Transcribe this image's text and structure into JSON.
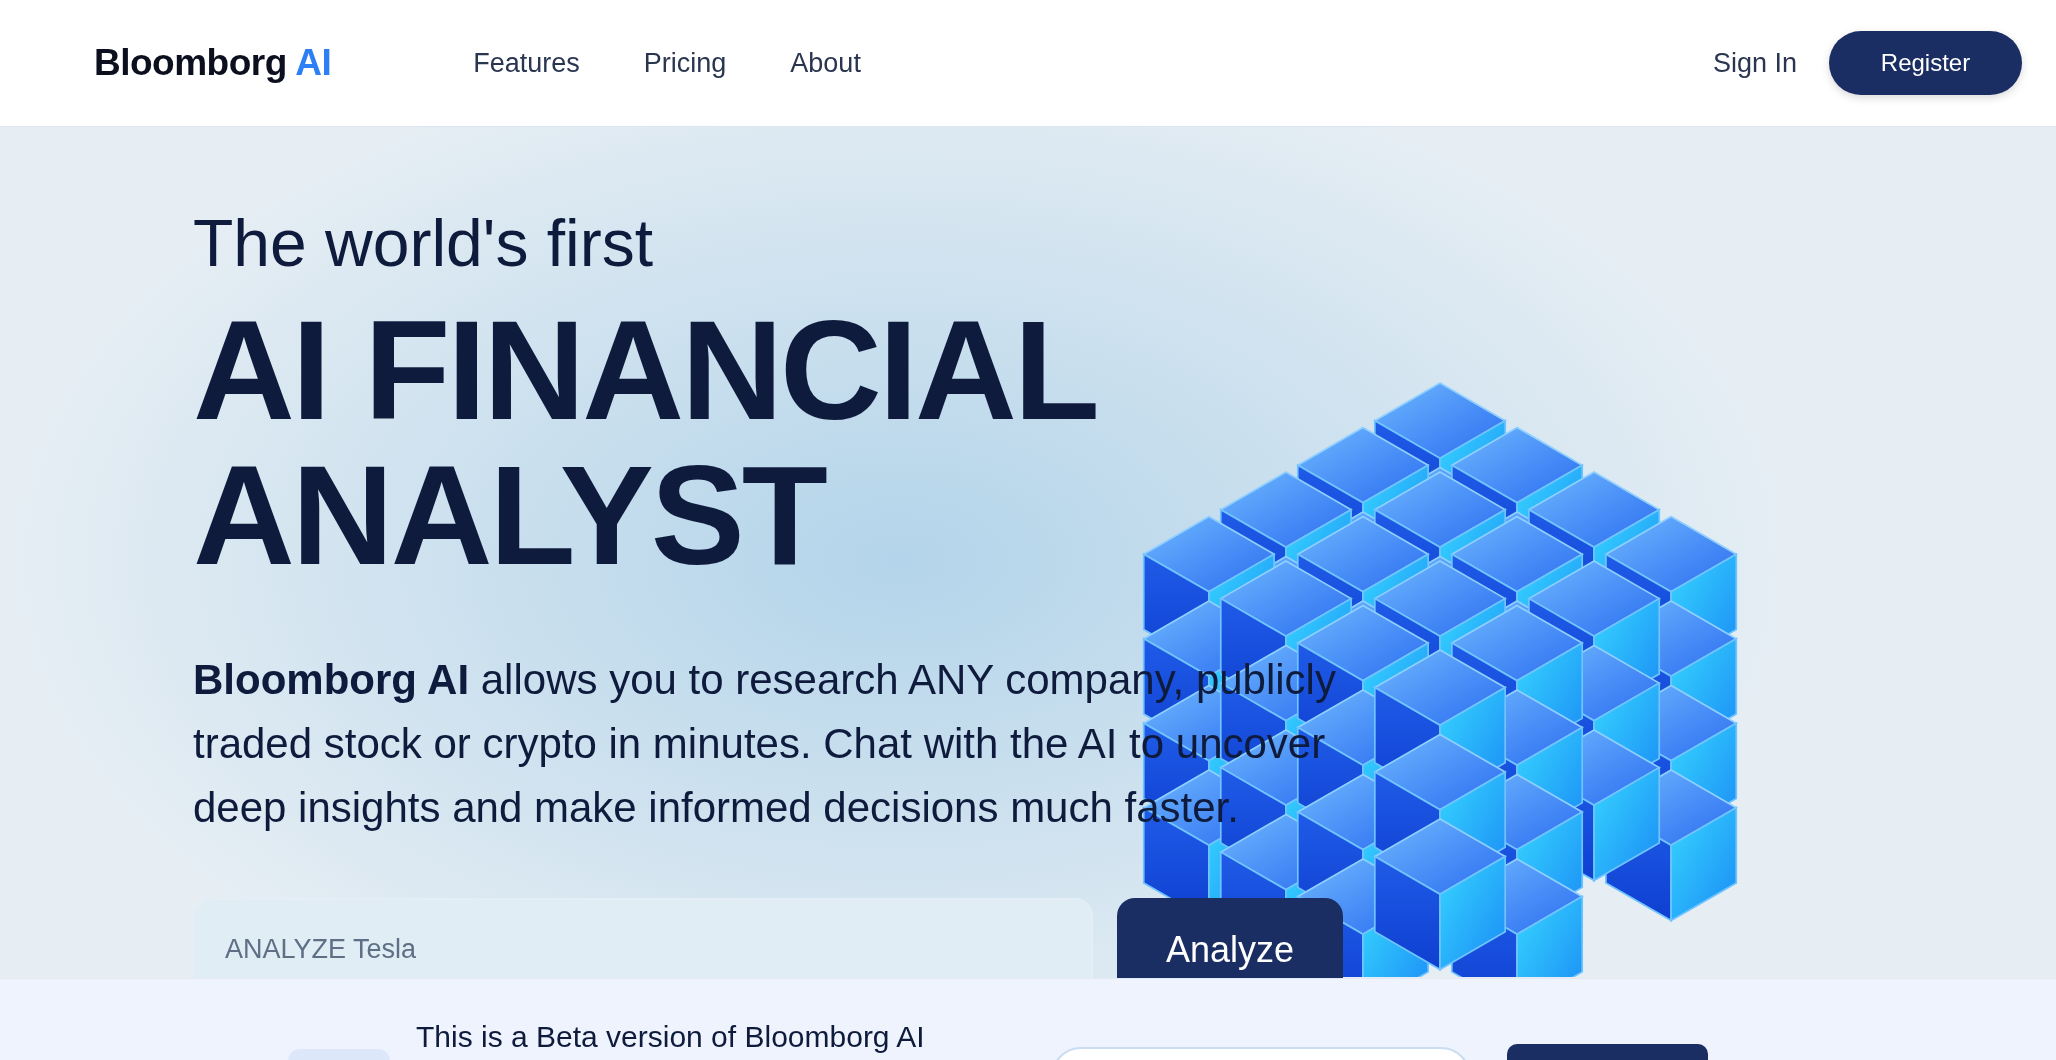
{
  "header": {
    "logo": {
      "text": "Bloomborg",
      "accent": "AI"
    },
    "nav": [
      "Features",
      "Pricing",
      "About"
    ],
    "sign_in": "Sign In",
    "register": "Register"
  },
  "hero": {
    "kicker": "The world's first",
    "headline_lines": [
      "AI FINANCIAL",
      "ANALYST"
    ],
    "description": "**Bloomborg AI** allows you to research ANY company, publicly traded stock or crypto in minutes. Chat with the AI to uncover deep insights and make informed decisions much faster.",
    "search": {
      "placeholder": "ANALYZE Tesla"
    },
    "analyze_button": "Analyze"
  },
  "beta_banner": {
    "message": "This is a Beta version of Bloomborg AI"
  }
}
